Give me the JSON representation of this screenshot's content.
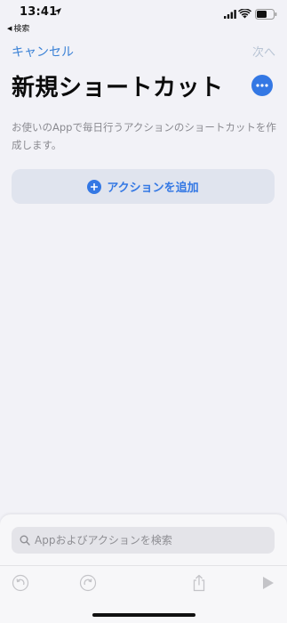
{
  "status_bar": {
    "time": "13:41",
    "back_app_label": "検索",
    "icons": [
      "location-arrow-icon",
      "signal-icon",
      "wifi-icon",
      "battery-icon"
    ]
  },
  "nav": {
    "cancel_label": "キャンセル",
    "next_label": "次へ"
  },
  "header": {
    "title": "新規ショートカット",
    "more_icon": "ellipsis-icon"
  },
  "description": "お使いのAppで毎日行うアクションのショートカットを作成します。",
  "add_action": {
    "label": "アクションを追加",
    "icon": "plus-circle-icon"
  },
  "bottom_panel": {
    "search_placeholder": "Appおよびアクションを検索",
    "toolbar_icons": [
      "undo-icon",
      "redo-icon",
      "share-icon",
      "play-icon"
    ]
  },
  "colors": {
    "accent": "#3478e4",
    "background": "#f2f2f7",
    "disabled_text": "#b8c4d4",
    "secondary_text": "#8a8a90"
  }
}
